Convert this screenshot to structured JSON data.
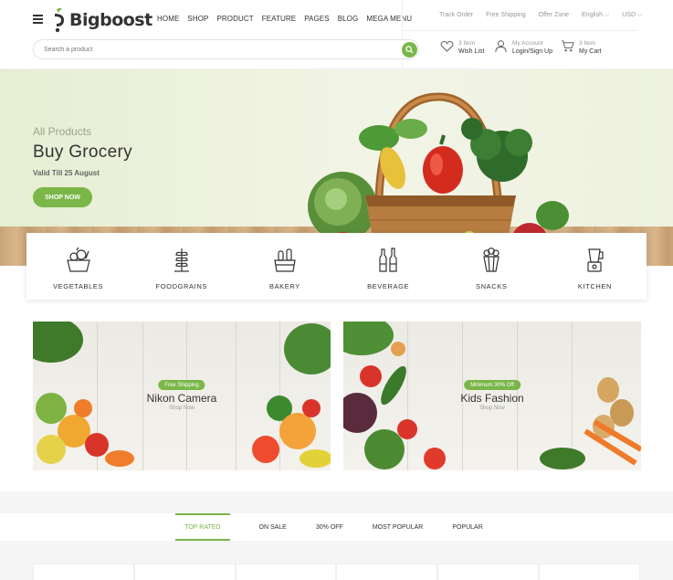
{
  "header": {
    "logo_text": "Bigboost",
    "nav": [
      "HOME",
      "SHOP",
      "PRODUCT",
      "FEATURE",
      "PAGES",
      "BLOG",
      "MEGA MENU"
    ],
    "topbar": [
      "Track Order",
      "Free Shipping",
      "Offer Zone",
      "English ⌵",
      "USD ⌵"
    ],
    "search_placeholder": "Search a product",
    "wishlist": {
      "count": "3 Item",
      "label": "Wish List"
    },
    "account": {
      "title": "My Account",
      "label": "Login/Sign Up"
    },
    "cart": {
      "count": "3 Item",
      "label": "My Cart"
    }
  },
  "hero": {
    "subtitle": "All Products",
    "title": "Buy Grocery",
    "valid": "Valid Till 25 August",
    "button": "SHOP NOW"
  },
  "categories": [
    {
      "label": "VEGETABLES",
      "icon": "vegetables-icon"
    },
    {
      "label": "FOODGRAINS",
      "icon": "wheat-icon"
    },
    {
      "label": "BAKERY",
      "icon": "bakery-icon"
    },
    {
      "label": "BEVERAGE",
      "icon": "bottles-icon"
    },
    {
      "label": "SNACKS",
      "icon": "popcorn-icon"
    },
    {
      "label": "KITCHEN",
      "icon": "blender-icon"
    }
  ],
  "banners": [
    {
      "badge": "Free Shipping",
      "title": "Nikon Camera",
      "link": "Shop Now"
    },
    {
      "badge": "Minimum 30% Off",
      "title": "Kids Fashion",
      "link": "Shop Now"
    }
  ],
  "tabs": [
    "TOP RATED",
    "ON SALE",
    "30% OFF",
    "MOST POPULAR",
    "POPULAR"
  ],
  "colors": {
    "accent": "#7ab648",
    "text": "#333333"
  }
}
